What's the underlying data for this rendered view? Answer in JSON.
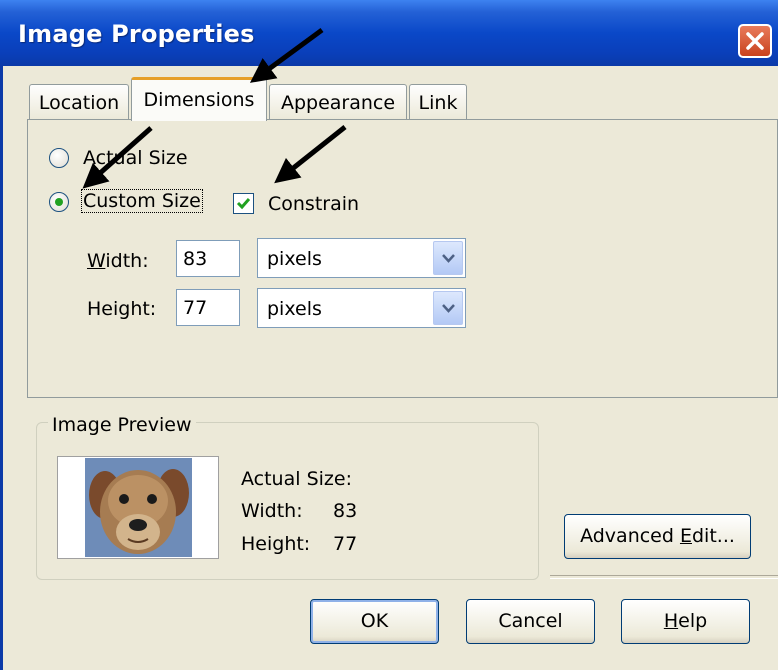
{
  "window": {
    "title": "Image Properties",
    "close_icon": "close-x-icon"
  },
  "tabs": [
    {
      "label": "Location",
      "active": false
    },
    {
      "label": "Dimensions",
      "active": true
    },
    {
      "label": "Appearance",
      "active": false
    },
    {
      "label": "Link",
      "active": false
    }
  ],
  "dimensions": {
    "actual_size_label": "Actual Size",
    "custom_size_label": "Custom Size",
    "custom_size_selected": true,
    "constrain_label": "Constrain",
    "constrain_checked": true,
    "width_label": "Width:",
    "width_value": "83",
    "width_unit": "pixels",
    "height_label": "Height:",
    "height_value": "77",
    "height_unit": "pixels"
  },
  "preview": {
    "group_title": "Image Preview",
    "actual_size_label": "Actual Size:",
    "width_label": "Width:",
    "width_value": "83",
    "height_label": "Height:",
    "height_value": "77"
  },
  "buttons": {
    "advanced_edit": "Advanced Edit...",
    "ok": "OK",
    "cancel": "Cancel",
    "help": "Help"
  },
  "colors": {
    "title_bar": "#0a48c8",
    "dialog_bg": "#ece9d8",
    "active_tab_accent": "#e69f28",
    "check_mark": "#21a121"
  }
}
